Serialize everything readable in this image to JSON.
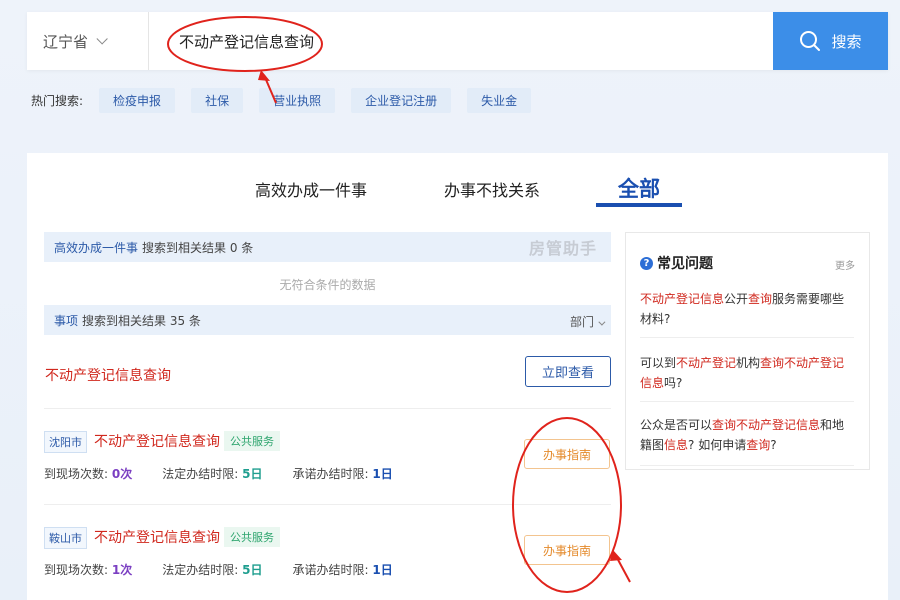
{
  "search": {
    "province": "辽宁省",
    "query": "不动产登记信息查询",
    "button_label": "搜索"
  },
  "hot": {
    "label": "热门搜索:",
    "items": [
      "检疫申报",
      "社保",
      "营业执照",
      "企业登记注册",
      "失业金"
    ]
  },
  "tabs": [
    "高效办成一件事",
    "办事不找关系",
    "全部"
  ],
  "section1": {
    "link": "高效办成一件事",
    "result_text": "搜索到相关结果 0 条",
    "watermark": "房管助手",
    "empty": "无符合条件的数据"
  },
  "section2": {
    "link": "事项",
    "result_text": "搜索到相关结果 35 条",
    "dept_label": "部门"
  },
  "feature": {
    "title": "不动产登记信息查询",
    "button": "立即查看"
  },
  "items": [
    {
      "city": "沈阳市",
      "title": "不动产登记信息查询",
      "tag": "公共服务",
      "visits_label": "到现场次数:",
      "visits_value": "0次",
      "legal_label": "法定办结时限:",
      "legal_value": "5日",
      "promise_label": "承诺办结时限:",
      "promise_value": "1日",
      "guide": "办事指南"
    },
    {
      "city": "鞍山市",
      "title": "不动产登记信息查询",
      "tag": "公共服务",
      "visits_label": "到现场次数:",
      "visits_value": "1次",
      "legal_label": "法定办结时限:",
      "legal_value": "5日",
      "promise_label": "承诺办结时限:",
      "promise_value": "1日",
      "guide": "办事指南"
    }
  ],
  "faq": {
    "title": "常见问题",
    "more": "更多",
    "questions": [
      [
        {
          "t": "不动产登记信息",
          "hl": true
        },
        {
          "t": "公开",
          "hl": false
        },
        {
          "t": "查询",
          "hl": true
        },
        {
          "t": "服务需要哪些材料?",
          "hl": false
        }
      ],
      [
        {
          "t": "可以到",
          "hl": false
        },
        {
          "t": "不动产登记",
          "hl": true
        },
        {
          "t": "机构",
          "hl": false
        },
        {
          "t": "查询不动产登记信息",
          "hl": true
        },
        {
          "t": "吗?",
          "hl": false
        }
      ],
      [
        {
          "t": "公众是否可以",
          "hl": false
        },
        {
          "t": "查询不动产登记信息",
          "hl": true
        },
        {
          "t": "和地籍图",
          "hl": false
        },
        {
          "t": "信息",
          "hl": true
        },
        {
          "t": "? 如何申请",
          "hl": false
        },
        {
          "t": "查询",
          "hl": true
        },
        {
          "t": "?",
          "hl": false
        }
      ]
    ]
  },
  "colors": {
    "accent": "#3c8ee8",
    "tab_active": "#1a4fb0",
    "highlight_red": "#d0281e",
    "annotation_red": "#e0231c"
  }
}
